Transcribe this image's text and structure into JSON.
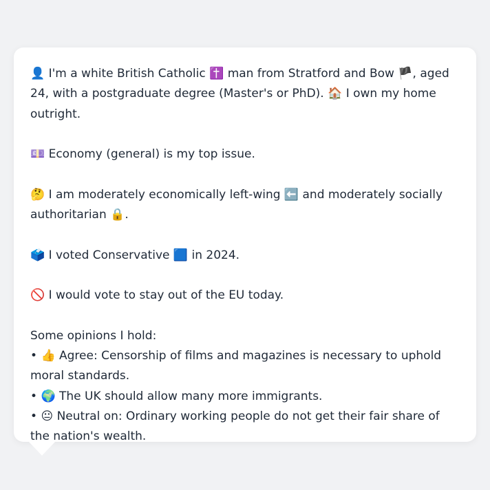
{
  "profile": {
    "identity_icon": "👤",
    "identity_text_1": "I'm a white British Catholic",
    "religion_icon": "✝️",
    "identity_text_2": "man from Stratford and Bow",
    "flag_icon": "🏴",
    "identity_text_3": ", aged 24, with a postgraduate degree (Master's or PhD).",
    "home_icon": "🏠",
    "identity_text_4": "I own my home outright."
  },
  "issue": {
    "icon": "💷",
    "text": "Economy (general) is my top issue."
  },
  "ideology": {
    "icon": "🤔",
    "text_1": "I am moderately economically left-wing",
    "left_icon": "⬅️",
    "text_2": "and moderately socially authoritarian",
    "lock_icon": "🔒",
    "text_3": "."
  },
  "vote": {
    "icon": "🗳️",
    "text_1": "I voted Conservative",
    "party_icon": "🟦",
    "text_2": "in 2024."
  },
  "eu": {
    "icon": "🚫",
    "text": "I would vote to stay out of the EU today."
  },
  "opinions": {
    "heading": "Some opinions I hold:",
    "bullet": "•",
    "items": [
      {
        "icon": "👍",
        "text": "Agree: Censorship of films and magazines is necessary to uphold moral standards."
      },
      {
        "icon": "🌍",
        "text": "The UK should allow many more immigrants."
      },
      {
        "icon": "😐",
        "text": "Neutral on: Ordinary working people do not get their fair share of the nation's wealth."
      }
    ]
  }
}
